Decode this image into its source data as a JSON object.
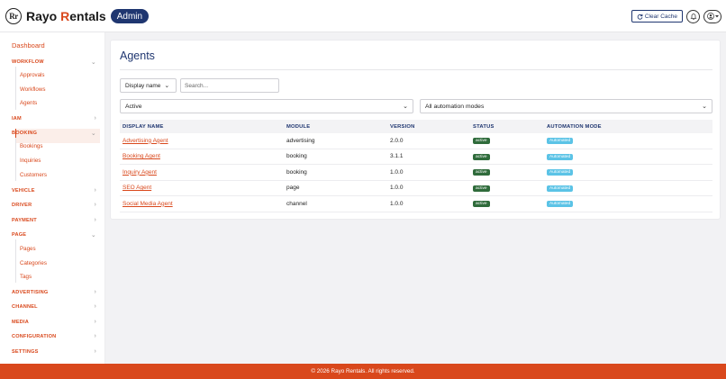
{
  "header": {
    "logo_text": "Rr",
    "brand_first": "Rayo ",
    "brand_r": "R",
    "brand_rest": "entals",
    "badge": "Admin",
    "clear_cache": "Clear Cache",
    "icons": [
      "refresh-icon",
      "bell-icon",
      "user-icon",
      "caret-down-icon"
    ]
  },
  "sidebar": {
    "dashboard": "Dashboard",
    "sections": [
      {
        "label": "WORKFLOW",
        "expanded": true,
        "items": [
          "Approvals",
          "Workflows",
          "Agents"
        ]
      },
      {
        "label": "IAM",
        "expanded": false
      },
      {
        "label": "BOOKING",
        "expanded": true,
        "items": [
          "Bookings",
          "Inquiries",
          "Customers"
        ]
      },
      {
        "label": "VEHICLE",
        "expanded": false
      },
      {
        "label": "DRIVER",
        "expanded": false
      },
      {
        "label": "PAYMENT",
        "expanded": false
      },
      {
        "label": "PAGE",
        "expanded": true,
        "items": [
          "Pages",
          "Categories",
          "Tags"
        ]
      },
      {
        "label": "ADVERTISING",
        "expanded": false
      },
      {
        "label": "CHANNEL",
        "expanded": false
      },
      {
        "label": "MEDIA",
        "expanded": false
      },
      {
        "label": "CONFIGURATION",
        "expanded": false
      },
      {
        "label": "SETTINGS",
        "expanded": false
      }
    ],
    "active_item": "Agents"
  },
  "main": {
    "title": "Agents",
    "sort_select": "Display name",
    "search_placeholder": "Search...",
    "status_filter": "Active",
    "mode_filter": "All automation modes",
    "table": {
      "columns": [
        "DISPLAY NAME",
        "MODULE",
        "VERSION",
        "STATUS",
        "AUTOMATION MODE"
      ],
      "rows": [
        {
          "name": "Advertising Agent",
          "module": "advertising",
          "version": "2.0.0",
          "status": "active",
          "mode": "Automated"
        },
        {
          "name": "Booking Agent",
          "module": "booking",
          "version": "3.1.1",
          "status": "active",
          "mode": "Automated"
        },
        {
          "name": "Inquiry Agent",
          "module": "booking",
          "version": "1.0.0",
          "status": "active",
          "mode": "Automated"
        },
        {
          "name": "SEO Agent",
          "module": "page",
          "version": "1.0.0",
          "status": "active",
          "mode": "Automated"
        },
        {
          "name": "Social Media Agent",
          "module": "channel",
          "version": "1.0.0",
          "status": "active",
          "mode": "Automated"
        }
      ]
    }
  },
  "footer": {
    "text": "© 2026 Rayo Rentals. All rights reserved."
  },
  "colors": {
    "accent": "#d9481c",
    "navy": "#1f3670",
    "active_badge": "#2f6b3b",
    "auto_badge": "#5bc3e6"
  }
}
